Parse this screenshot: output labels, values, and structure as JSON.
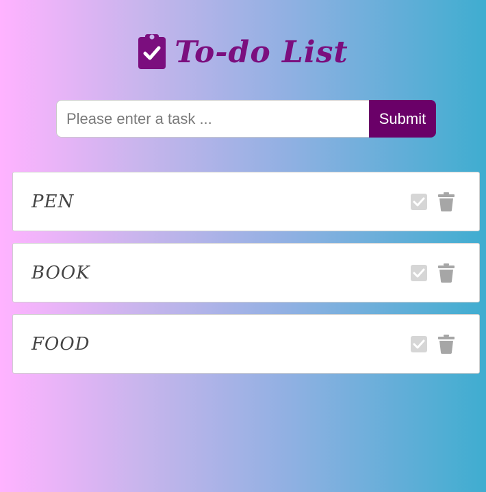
{
  "header": {
    "title": "To-do List",
    "icon": "clipboard-check-icon",
    "color": "#7b0e7e"
  },
  "form": {
    "placeholder": "Please enter a task ...",
    "submit_label": "Submit",
    "submit_color": "#6a0068"
  },
  "tasks": [
    {
      "label": "PEN",
      "check_icon": "checkbox-icon",
      "delete_icon": "trash-icon"
    },
    {
      "label": "BOOK",
      "check_icon": "checkbox-icon",
      "delete_icon": "trash-icon"
    },
    {
      "label": "FOOD",
      "check_icon": "checkbox-icon",
      "delete_icon": "trash-icon"
    }
  ]
}
